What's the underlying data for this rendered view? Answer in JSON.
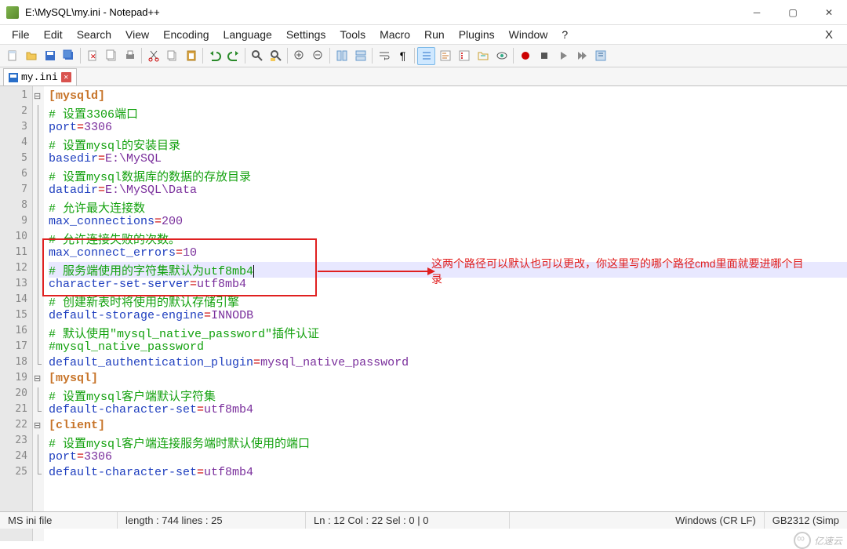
{
  "window": {
    "title": "E:\\MySQL\\my.ini - Notepad++"
  },
  "menus": [
    "File",
    "Edit",
    "Search",
    "View",
    "Encoding",
    "Language",
    "Settings",
    "Tools",
    "Macro",
    "Run",
    "Plugins",
    "Window",
    "?"
  ],
  "tab": {
    "filename": "my.ini"
  },
  "gutter_lines": 25,
  "code_lines": [
    {
      "n": 1,
      "tokens": [
        {
          "t": "[mysqld]",
          "c": "kw-sec"
        }
      ],
      "fold": "minus"
    },
    {
      "n": 2,
      "tokens": [
        {
          "t": "# 设置3306端口",
          "c": "kw-com"
        }
      ],
      "fold": "bar"
    },
    {
      "n": 3,
      "tokens": [
        {
          "t": "port",
          "c": "kw-key"
        },
        {
          "t": "=",
          "c": "kw-punc"
        },
        {
          "t": "3306",
          "c": "kw-val"
        }
      ],
      "fold": "bar"
    },
    {
      "n": 4,
      "tokens": [
        {
          "t": "# 设置mysql的安装目录",
          "c": "kw-com"
        }
      ],
      "fold": "bar"
    },
    {
      "n": 5,
      "tokens": [
        {
          "t": "basedir",
          "c": "kw-key"
        },
        {
          "t": "=",
          "c": "kw-punc"
        },
        {
          "t": "E:\\MySQL",
          "c": "kw-val"
        }
      ],
      "fold": "bar"
    },
    {
      "n": 6,
      "tokens": [
        {
          "t": "# 设置mysql数据库的数据的存放目录",
          "c": "kw-com"
        }
      ],
      "fold": "bar"
    },
    {
      "n": 7,
      "tokens": [
        {
          "t": "datadir",
          "c": "kw-key"
        },
        {
          "t": "=",
          "c": "kw-punc"
        },
        {
          "t": "E:\\MySQL\\Data",
          "c": "kw-val"
        }
      ],
      "fold": "bar"
    },
    {
      "n": 8,
      "tokens": [
        {
          "t": "# 允许最大连接数",
          "c": "kw-com"
        }
      ],
      "fold": "bar"
    },
    {
      "n": 9,
      "tokens": [
        {
          "t": "max_connections",
          "c": "kw-key"
        },
        {
          "t": "=",
          "c": "kw-punc"
        },
        {
          "t": "200",
          "c": "kw-val"
        }
      ],
      "fold": "bar"
    },
    {
      "n": 10,
      "tokens": [
        {
          "t": "# 允许连接失败的次数。",
          "c": "kw-com"
        }
      ],
      "fold": "bar"
    },
    {
      "n": 11,
      "tokens": [
        {
          "t": "max_connect_errors",
          "c": "kw-key"
        },
        {
          "t": "=",
          "c": "kw-punc"
        },
        {
          "t": "10",
          "c": "kw-val"
        }
      ],
      "fold": "bar"
    },
    {
      "n": 12,
      "tokens": [
        {
          "t": "# 服务端使用的字符集默认为utf8mb4",
          "c": "kw-com"
        }
      ],
      "fold": "bar",
      "hl": true,
      "cursor": true
    },
    {
      "n": 13,
      "tokens": [
        {
          "t": "character-set-server",
          "c": "kw-key"
        },
        {
          "t": "=",
          "c": "kw-punc"
        },
        {
          "t": "utf8mb4",
          "c": "kw-val"
        }
      ],
      "fold": "bar"
    },
    {
      "n": 14,
      "tokens": [
        {
          "t": "# 创建新表时将使用的默认存储引擎",
          "c": "kw-com"
        }
      ],
      "fold": "bar"
    },
    {
      "n": 15,
      "tokens": [
        {
          "t": "default-storage-engine",
          "c": "kw-key"
        },
        {
          "t": "=",
          "c": "kw-punc"
        },
        {
          "t": "INNODB",
          "c": "kw-val"
        }
      ],
      "fold": "bar"
    },
    {
      "n": 16,
      "tokens": [
        {
          "t": "# 默认使用\"mysql_native_password\"插件认证",
          "c": "kw-com"
        }
      ],
      "fold": "bar"
    },
    {
      "n": 17,
      "tokens": [
        {
          "t": "#mysql_native_password",
          "c": "kw-com"
        }
      ],
      "fold": "bar"
    },
    {
      "n": 18,
      "tokens": [
        {
          "t": "default_authentication_plugin",
          "c": "kw-key"
        },
        {
          "t": "=",
          "c": "kw-punc"
        },
        {
          "t": "mysql_native_password",
          "c": "kw-val"
        }
      ],
      "fold": "end"
    },
    {
      "n": 19,
      "tokens": [
        {
          "t": "[mysql]",
          "c": "kw-sec"
        }
      ],
      "fold": "minus"
    },
    {
      "n": 20,
      "tokens": [
        {
          "t": "# 设置mysql客户端默认字符集",
          "c": "kw-com"
        }
      ],
      "fold": "bar"
    },
    {
      "n": 21,
      "tokens": [
        {
          "t": "default-character-set",
          "c": "kw-key"
        },
        {
          "t": "=",
          "c": "kw-punc"
        },
        {
          "t": "utf8mb4",
          "c": "kw-val"
        }
      ],
      "fold": "end"
    },
    {
      "n": 22,
      "tokens": [
        {
          "t": "[client]",
          "c": "kw-sec"
        }
      ],
      "fold": "minus"
    },
    {
      "n": 23,
      "tokens": [
        {
          "t": "# 设置mysql客户端连接服务端时默认使用的端口",
          "c": "kw-com"
        }
      ],
      "fold": "bar"
    },
    {
      "n": 24,
      "tokens": [
        {
          "t": "port",
          "c": "kw-key"
        },
        {
          "t": "=",
          "c": "kw-punc"
        },
        {
          "t": "3306",
          "c": "kw-val"
        }
      ],
      "fold": "bar"
    },
    {
      "n": 25,
      "tokens": [
        {
          "t": "default-character-set",
          "c": "kw-key"
        },
        {
          "t": "=",
          "c": "kw-punc"
        },
        {
          "t": "utf8mb4",
          "c": "kw-val"
        }
      ],
      "fold": "end"
    }
  ],
  "annotation": "这两个路径可以默认也可以更改，你这里写的哪个路径cmd里面就要进哪个目录",
  "status": {
    "filetype": "MS ini file",
    "length": "length : 744    lines : 25",
    "position": "Ln : 12    Col : 22    Sel : 0 | 0",
    "eol": "Windows (CR LF)",
    "encoding": "GB2312 (Simp"
  },
  "watermark": "亿速云"
}
